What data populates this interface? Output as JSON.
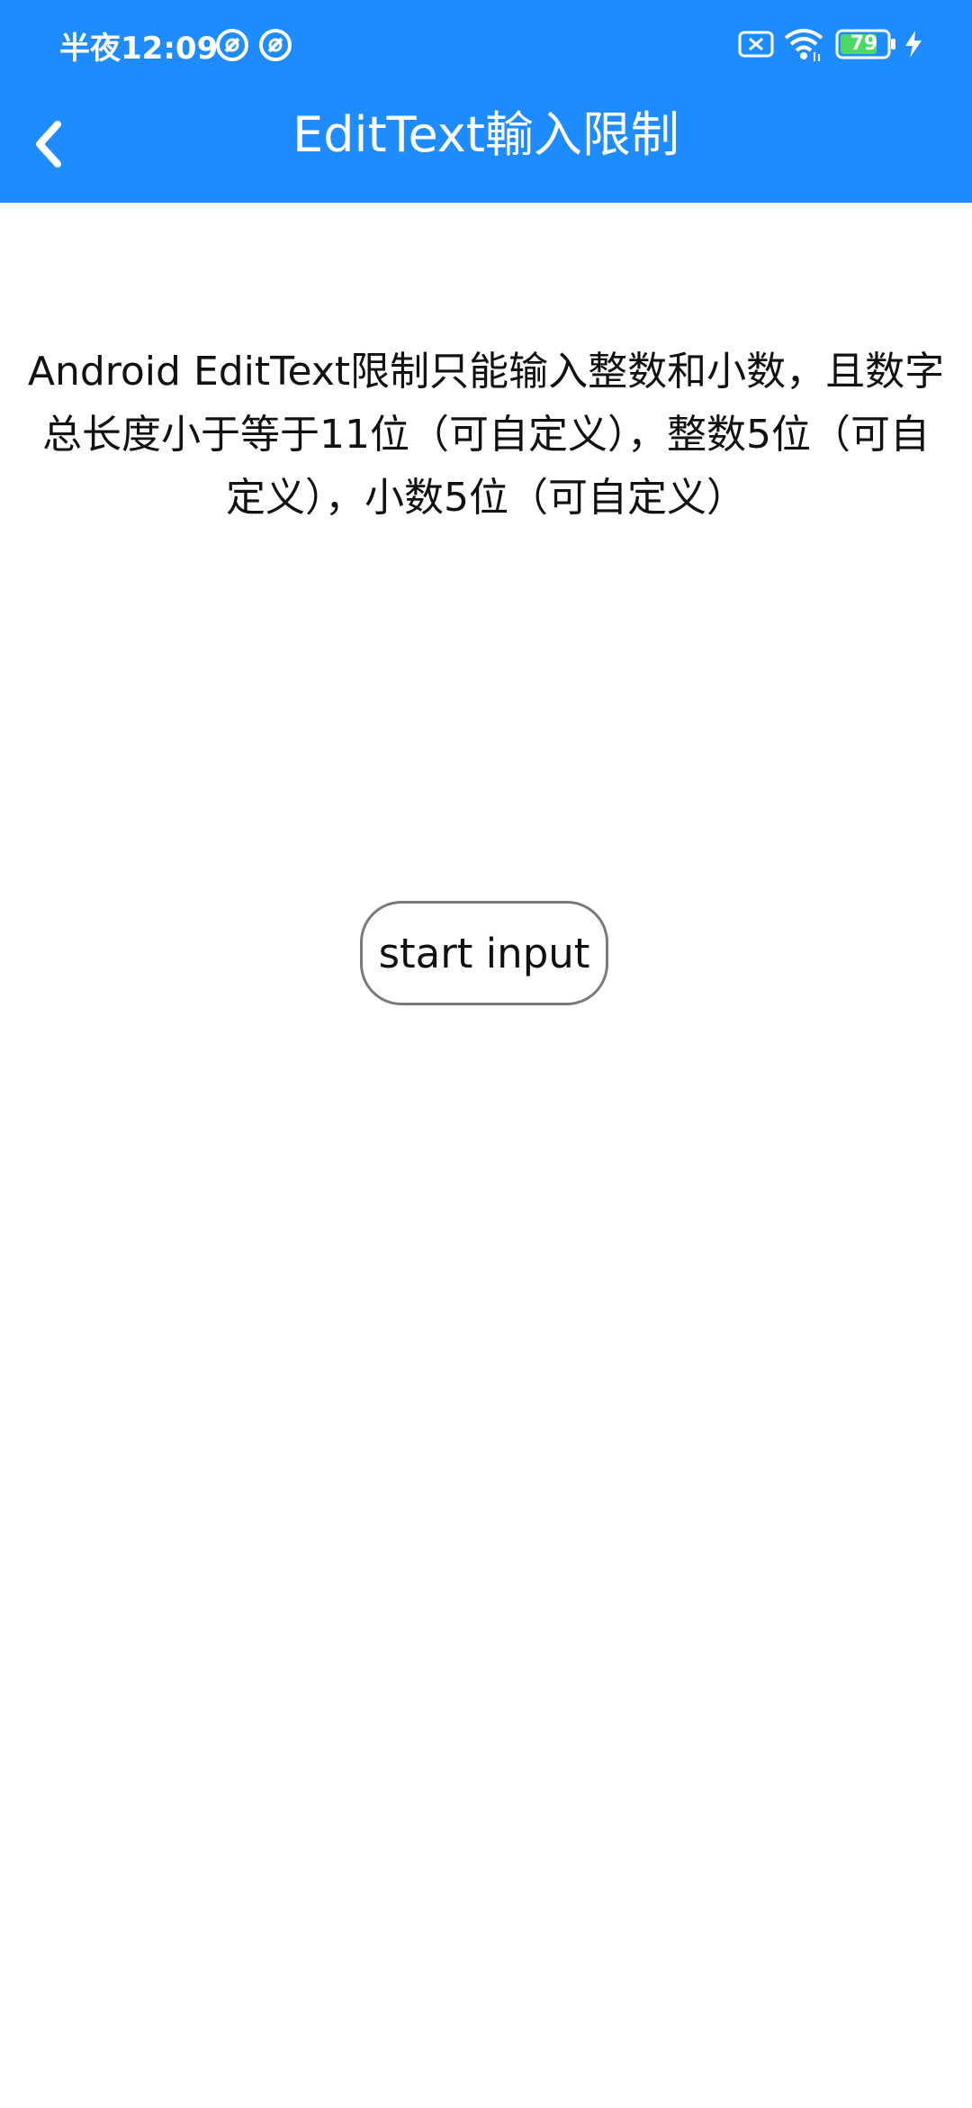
{
  "status_bar": {
    "time": "半夜12:09",
    "battery_level": "79",
    "icons": [
      "notification-icon",
      "notification-icon",
      "sim-off-icon",
      "wifi-icon",
      "battery-icon",
      "charging-icon"
    ],
    "battery_color": "#4cd964"
  },
  "app_bar": {
    "title": "EditText輸入限制",
    "back_icon": "chevron-left-icon",
    "background": "#1e8cff"
  },
  "content": {
    "description": "Android EditText限制只能输入整数和小数，且数字总长度小于等于11位（可自定义），整数5位（可自定义），小数5位（可自定义）",
    "start_button_label": "start input"
  }
}
